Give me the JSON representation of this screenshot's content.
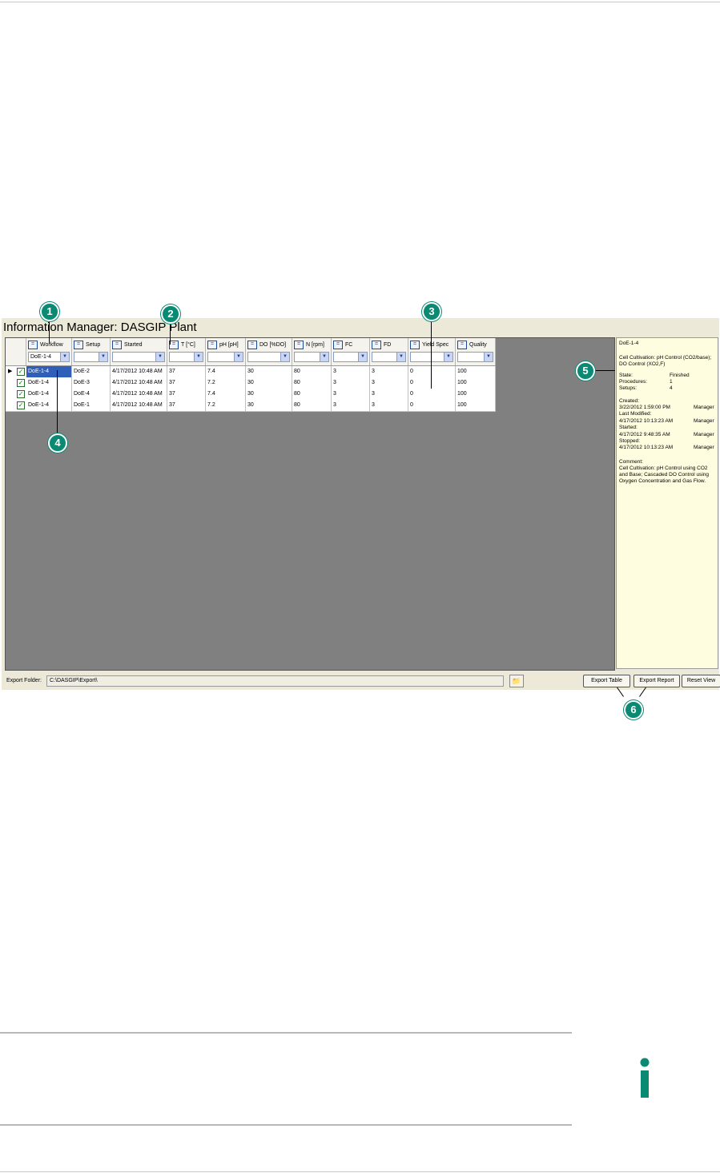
{
  "window_title": "Information Manager: DASGIP Plant",
  "columns": [
    {
      "label": "Workflow",
      "filter": "DoE-1-4"
    },
    {
      "label": "Setup",
      "filter": ""
    },
    {
      "label": "Started",
      "filter": ""
    },
    {
      "label": "T [°C]",
      "filter": ""
    },
    {
      "label": "pH [pH]",
      "filter": ""
    },
    {
      "label": "DO [%DO]",
      "filter": ""
    },
    {
      "label": "N [rpm]",
      "filter": ""
    },
    {
      "label": "FC",
      "filter": ""
    },
    {
      "label": "FD",
      "filter": ""
    },
    {
      "label": "Yield Spec",
      "filter": ""
    },
    {
      "label": "Quality",
      "filter": ""
    }
  ],
  "eq_symbol": "=",
  "rows": [
    {
      "checked": true,
      "current": true,
      "cells": [
        "DoE-1-4",
        "DoE-2",
        "4/17/2012 10:48 AM",
        "37",
        "7.4",
        "30",
        "80",
        "3",
        "3",
        "0",
        "100"
      ]
    },
    {
      "checked": true,
      "current": false,
      "cells": [
        "DoE-1-4",
        "DoE-3",
        "4/17/2012 10:48 AM",
        "37",
        "7.2",
        "30",
        "80",
        "3",
        "3",
        "0",
        "100"
      ]
    },
    {
      "checked": true,
      "current": false,
      "cells": [
        "DoE-1-4",
        "DoE-4",
        "4/17/2012 10:48 AM",
        "37",
        "7.4",
        "30",
        "80",
        "3",
        "3",
        "0",
        "100"
      ]
    },
    {
      "checked": true,
      "current": false,
      "cells": [
        "DoE-1-4",
        "DoE-1",
        "4/17/2012 10:48 AM",
        "37",
        "7.2",
        "30",
        "80",
        "3",
        "3",
        "0",
        "100"
      ]
    }
  ],
  "info_panel": {
    "title": "DoE-1-4",
    "description_1": "Cell Cultivation: pH Control (CO2/base);",
    "description_2": "DO Control (XO2,F)",
    "state_label": "State:",
    "state_value": "Finished",
    "procedures_label": "Procedures:",
    "procedures_value": "1",
    "setups_label": "Setups:",
    "setups_value": "4",
    "created_label": "Created:",
    "created_value": "3/22/2012 1:59:00 PM",
    "created_user": "Manager",
    "modified_label": "Last Modified:",
    "modified_value": "4/17/2012 10:13:23 AM",
    "modified_user": "Manager",
    "started_label": "Started:",
    "started_value": "4/17/2012 9:48:35 AM",
    "started_user": "Manager",
    "stopped_label": "Stopped:",
    "stopped_value": "4/17/2012 10:13:23 AM",
    "stopped_user": "Manager",
    "comment_label": "Comment:",
    "comment_1": "Cell Cultivation: pH Control using CO2",
    "comment_2": "and Base; Cascaded DO Control using",
    "comment_3": "Oxygen Concentration and Gas Flow."
  },
  "bottom": {
    "export_folder_label": "Export Folder:",
    "export_folder_value": "C:\\DASGIP\\Export\\",
    "export_table": "Export Table",
    "export_report": "Export Report",
    "reset_view": "Reset View"
  },
  "callouts": [
    "1",
    "2",
    "3",
    "4",
    "5",
    "6"
  ],
  "info_icon": "info-icon",
  "colors": {
    "accent": "#0b8a73",
    "selection": "#2f5fb8",
    "grid_bg": "#808080",
    "panel_bg": "#fffde0"
  }
}
